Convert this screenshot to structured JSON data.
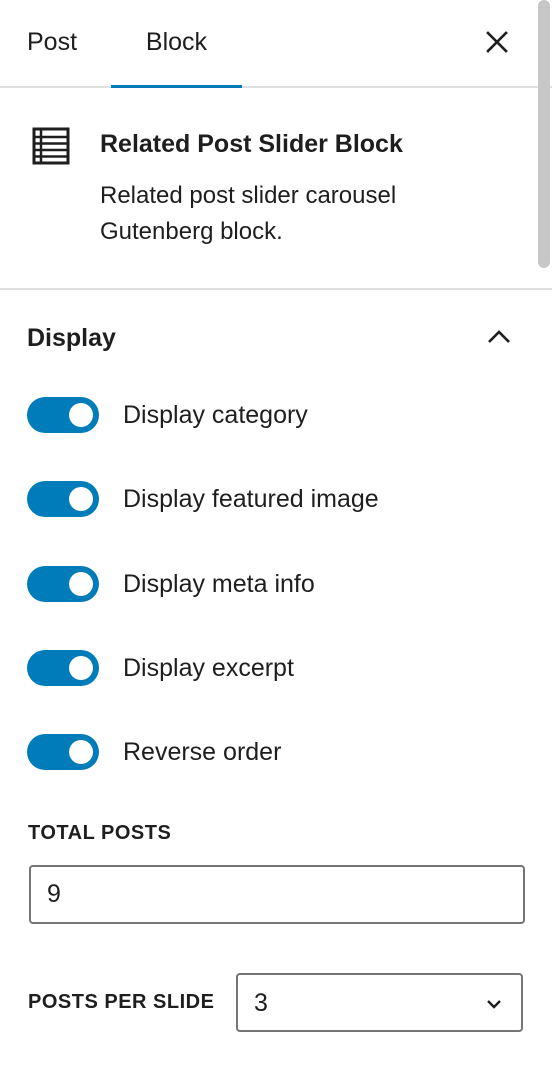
{
  "tabs": {
    "post_label": "Post",
    "block_label": "Block",
    "active": "Block"
  },
  "header": {
    "close_icon": "close-icon"
  },
  "block_card": {
    "icon": "list-view-icon",
    "title": "Related Post Slider Block",
    "description": "Related post slider carousel Gutenberg block."
  },
  "display_section": {
    "title": "Display",
    "expanded": true,
    "toggles": [
      {
        "label": "Display category",
        "checked": true
      },
      {
        "label": "Display featured image",
        "checked": true
      },
      {
        "label": "Display meta info",
        "checked": true
      },
      {
        "label": "Display excerpt",
        "checked": true
      },
      {
        "label": "Reverse order",
        "checked": true
      }
    ],
    "total_posts": {
      "label": "TOTAL POSTS",
      "value": "9"
    },
    "posts_per_slide": {
      "label": "POSTS PER SLIDE",
      "value": "3"
    }
  },
  "colors": {
    "accent": "#007cba",
    "text": "#1e1e1e",
    "border": "#757575",
    "divider": "#e0e0e0"
  }
}
